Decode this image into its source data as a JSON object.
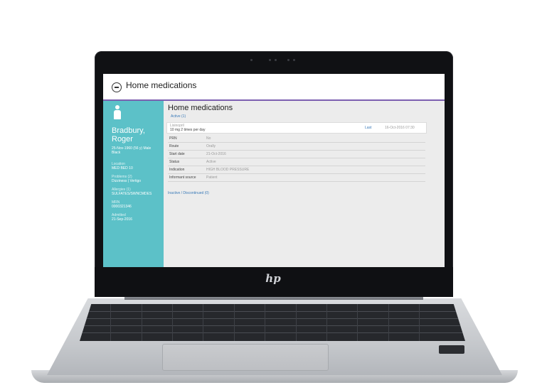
{
  "app": {
    "title": "Home medications"
  },
  "patient": {
    "first_line": "Bradbury,",
    "second_line": "Roger",
    "demographics_1": "25-Nov-1960 (56 y) Male",
    "demographics_2": "Black",
    "fields": [
      {
        "label": "Location",
        "value": "MED BED 10"
      },
      {
        "label": "Problems (2)",
        "value": "Dizziness | Vertigo"
      },
      {
        "label": "Allergies (1)",
        "value": "SULFATES/SWNCMDES"
      },
      {
        "label": "MRN",
        "value": "0000321346"
      },
      {
        "label": "Admitted",
        "value": "21-Sep-2016"
      }
    ]
  },
  "main": {
    "title": "Home medications",
    "active_tab": "Active (1)",
    "summary": {
      "drug": "Lisinopril",
      "dose": "10 mg 2 times per day",
      "last_label": "Last",
      "last_value": "16-Oct-2016 07:30"
    },
    "details": [
      {
        "key": "PRN",
        "value": "No"
      },
      {
        "key": "Route",
        "value": "Orally"
      },
      {
        "key": "Start date",
        "value": "21-Oct-2016"
      },
      {
        "key": "Status",
        "value": "Active"
      },
      {
        "key": "Indication",
        "value": "HIGH BLOOD PRESSURE"
      },
      {
        "key": "Informant source",
        "value": "Patient"
      }
    ],
    "inactive_link": "Inactive / Discontinued (0)"
  },
  "device": {
    "brand_logo": "hp"
  },
  "colors": {
    "sidebar": "#5cc1c8",
    "accent": "#7c5fb0",
    "link": "#3a7ab8"
  }
}
